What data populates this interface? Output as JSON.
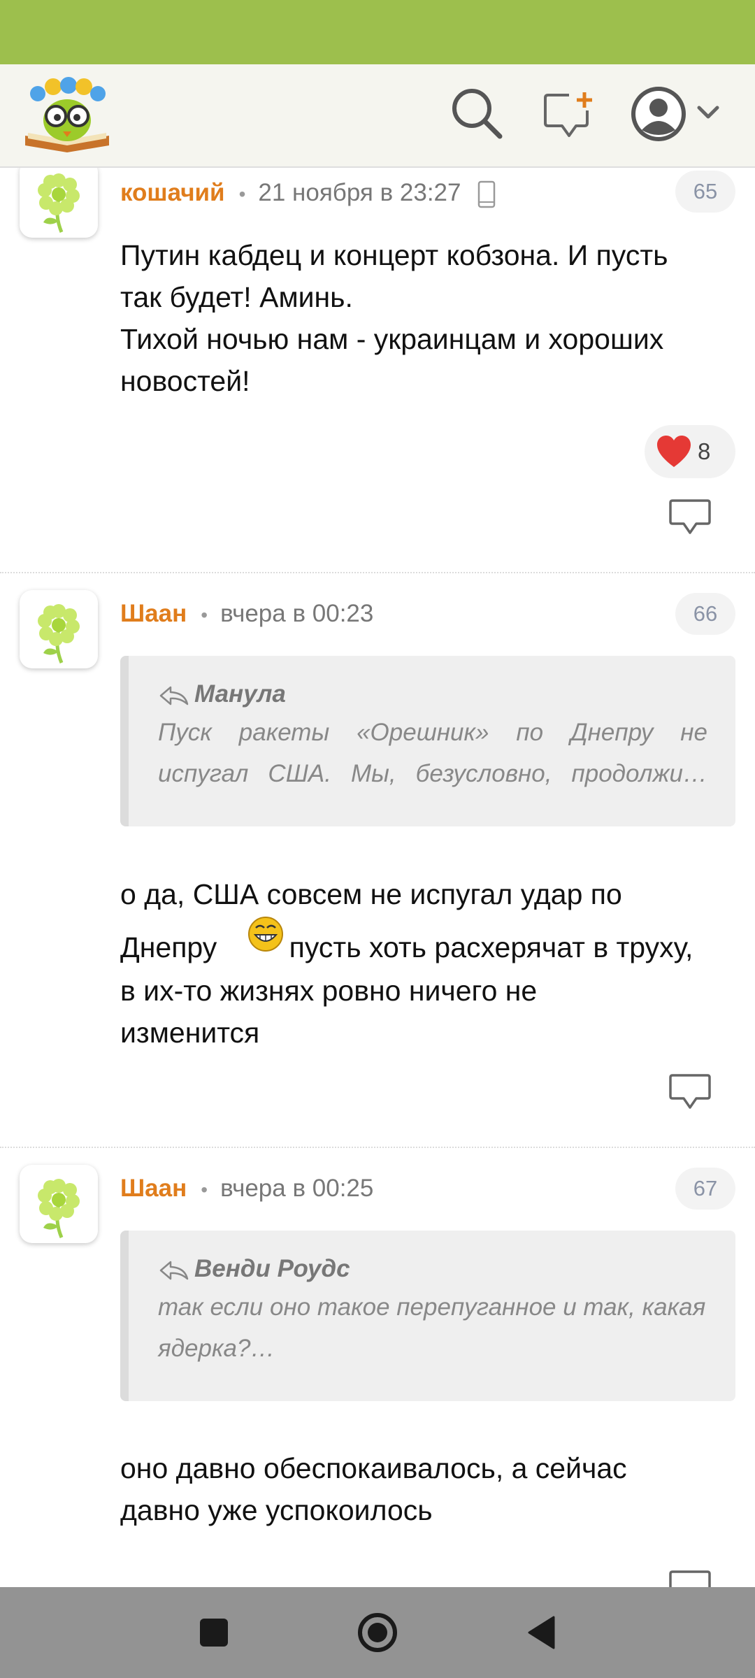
{
  "colors": {
    "status_bar": "#9dbf4d",
    "author": "#e07d1c",
    "heart": "#e53935",
    "nav_bar": "#939393"
  },
  "header": {
    "logo_icon": "book-owl-logo-icon",
    "search_icon": "search-icon",
    "new_post_icon": "new-message-plus-icon",
    "profile_icon": "user-avatar-icon",
    "dropdown_icon": "chevron-down-icon"
  },
  "comments": [
    {
      "author": "кошачий",
      "time": "21 ноября в 23:27",
      "device_icon": "mobile-phone-icon",
      "number": "65",
      "text_lines": [
        "Путин кабдец и концерт кобзона. И пусть",
        "так будет! Аминь.",
        "Тихой ночью нам - украинцам и хороших",
        "новостей!"
      ],
      "likes": "8"
    },
    {
      "author": "Шаан",
      "time": "вчера в 00:23",
      "number": "66",
      "quote": {
        "author": "Манула",
        "lines": [
          "Пуск ракеты «Орешник» по Днепру не",
          "испугал США. Мы, безусловно, продолжи…"
        ]
      },
      "text_lines": [
        "о да, США совсем не испугал удар по",
        "Днепру",
        "пусть хоть расхерячат в труху,",
        "в их-то жизнях ровно ничего не",
        "изменится"
      ],
      "emoji": "grinning-smiley-icon"
    },
    {
      "author": "Шаан",
      "time": "вчера в 00:25",
      "number": "67",
      "quote": {
        "author": "Венди Роудс",
        "lines": [
          "так если оно такое перепуганное и так, какая",
          "ядерка?…"
        ]
      },
      "text_lines": [
        "оно давно обеспокаивалось, а сейчас",
        "давно уже успокоилось"
      ]
    }
  ],
  "nav": {
    "recents_icon": "square-recents-icon",
    "home_icon": "circle-home-icon",
    "back_icon": "triangle-back-icon"
  }
}
